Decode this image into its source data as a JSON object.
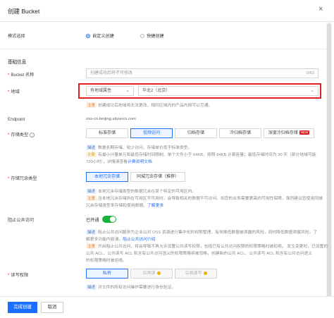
{
  "dialog": {
    "title": "创建 Bucket",
    "close_symbol": "×"
  },
  "mode": {
    "label": "模式选择",
    "options": [
      {
        "label": "自定义创建",
        "selected": true
      },
      {
        "label": "快捷创建",
        "selected": false
      }
    ]
  },
  "basic_section": "基础信息",
  "bucket_name": {
    "label": "Bucket 名称",
    "placeholder": "创建成功后将不可修改",
    "counter": "0/63"
  },
  "region": {
    "label": "地域",
    "type_value": "有地域属性",
    "region_value": "华北2（北京）",
    "note_tag": "注意",
    "note": "创建成功后地域将无法更改，相同区域内的产品内网可以互通。"
  },
  "endpoint": {
    "label": "Endpoint",
    "value": "oss-cn-beijing.aliyuncs.com"
  },
  "storage_class": {
    "label": "存储类型",
    "options": [
      {
        "label": "标准存储",
        "selected": false
      },
      {
        "label": "低频访问",
        "selected": true
      },
      {
        "label": "归档存储",
        "selected": false
      },
      {
        "label": "冷归档存储",
        "selected": false
      },
      {
        "label": "深度冷归档存储",
        "selected": false
      }
    ],
    "new_badge": "NEW",
    "desc_tag": "描述",
    "desc": "数据长期存储、较少访问，存储单价低于标准类型。",
    "bill_tag": "计费",
    "bill_1": "有最小计量单元和最低存储时间限制，单个文件小于 64KB，按照 64KB 计算容量；最低存储时间为 30 天（部分地域可能",
    "bill_2": "720小时），详情请查看",
    "bill_link": "计费说明文档"
  },
  "redundancy": {
    "label": "存储冗余类型",
    "options": [
      {
        "label": "本地冗余存储",
        "selected": true
      },
      {
        "label": "同城冗余存储（推荐）",
        "selected": false
      }
    ],
    "desc_tag": "描述",
    "desc": "本地冗余存储类型的数据冗余在某个特定的可用区内。",
    "note_tag": "注意",
    "note_1": "当本地冗余存储所在可用区不可用时，会导致相关的数据不可访问。如您的业务需要更高的可用性保障，强烈建议您使用同城",
    "note_2": "冗余存储类型来存储和使用数据。",
    "note_link": "了解更多"
  },
  "block_public": {
    "label": "阻止公共访问",
    "state": "已开通",
    "desc_tag": "描述",
    "desc_1": "阻止公共访问服务为企业以对 OSS 资源进行集中化的权限管理，有效降低数据被泄露的风险，同时降低数据泄露风险，了",
    "desc_2": "解更多功能内容请，",
    "desc_link": "阻止公共访问介绍",
    "note_tag": "注意",
    "note_1": "开启阻止公共访问，将会导致不再允许设置公共读写权限，包括已有公共访问权限的权限策略时被拒绝。 发生变更时，已设置的",
    "note_2": "公共 ACL、公共读写 ACL 和含有公共访问语义的权限策略将被忽略，创建新的公共 ACL、公共读写 ACL 和含有公共访问语义",
    "note_3": "的权限策略时被拒绝。"
  },
  "acl": {
    "label": "读写权限",
    "options": [
      {
        "label": "私有",
        "selected": true
      },
      {
        "label": "公共读",
        "selected": false
      },
      {
        "label": "公共读写",
        "selected": false
      }
    ],
    "desc_tag": "描述",
    "desc": "对文件的所有访问操作需要进行身份验证。"
  },
  "footer": {
    "submit": "完成创建",
    "cancel": "取消"
  }
}
